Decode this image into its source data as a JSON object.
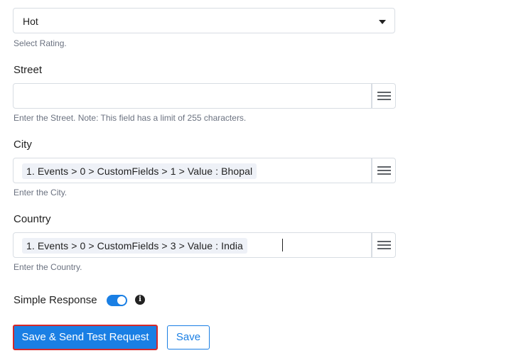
{
  "rating": {
    "selected_value": "Hot",
    "hint": "Select Rating."
  },
  "street": {
    "label": "Street",
    "value": "",
    "hint": "Enter the Street. Note: This field has a limit of 255 characters."
  },
  "city": {
    "label": "City",
    "token": "1. Events > 0 > CustomFields > 1 > Value : Bhopal",
    "hint": "Enter the City."
  },
  "country": {
    "label": "Country",
    "token": "1. Events > 0 > CustomFields > 3 > Value : India",
    "hint": "Enter the Country."
  },
  "simple_response": {
    "label": "Simple Response",
    "enabled": true,
    "info_glyph": "i"
  },
  "actions": {
    "save_send_label": "Save & Send Test Request",
    "save_label": "Save"
  },
  "colors": {
    "accent": "#1a7fe4",
    "highlight_border": "#d62828",
    "chip_bg": "#eef1f7"
  },
  "icons": [
    "chevron-down-icon",
    "hamburger-menu-icon",
    "info-icon"
  ]
}
